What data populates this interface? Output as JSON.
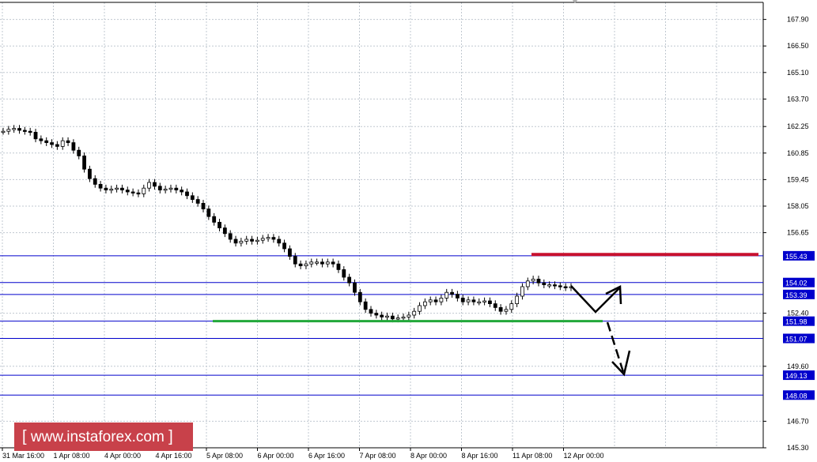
{
  "chart_data": {
    "type": "candlestick",
    "y_axis_ticks": [
      "167.90",
      "166.50",
      "165.10",
      "163.70",
      "162.25",
      "160.85",
      "159.45",
      "158.05",
      "156.65",
      "154.02",
      "153.39",
      "152.40",
      "151.98",
      "151.07",
      "149.60",
      "149.13",
      "148.08",
      "146.70",
      "145.30"
    ],
    "x_axis_ticks": [
      "31 Mar 16:00",
      "1 Apr 08:00",
      "4 Apr 00:00",
      "4 Apr 16:00",
      "5 Apr 08:00",
      "6 Apr 00:00",
      "6 Apr 16:00",
      "7 Apr 08:00",
      "8 Apr 00:00",
      "8 Apr 16:00",
      "11 Apr 08:00",
      "12 Apr 00:00"
    ],
    "ylim": [
      145.3,
      168.8
    ],
    "grid": true,
    "price_candles": [
      162.0,
      162.1,
      162.15,
      162.05,
      162.0,
      161.95,
      161.6,
      161.5,
      161.4,
      161.3,
      161.2,
      161.5,
      161.4,
      161.0,
      160.7,
      160.0,
      159.5,
      159.2,
      159.0,
      158.9,
      158.95,
      159.0,
      158.9,
      158.8,
      158.75,
      158.7,
      159.0,
      159.3,
      159.1,
      158.9,
      158.95,
      159.0,
      158.9,
      158.8,
      158.6,
      158.4,
      158.2,
      157.9,
      157.5,
      157.2,
      156.9,
      156.6,
      156.3,
      156.1,
      156.2,
      156.3,
      156.2,
      156.25,
      156.35,
      156.4,
      156.3,
      156.1,
      155.8,
      155.4,
      155.0,
      154.9,
      155.0,
      155.1,
      155.1,
      155.0,
      155.1,
      155.0,
      154.7,
      154.3,
      154.0,
      153.5,
      153.0,
      152.6,
      152.4,
      152.3,
      152.2,
      152.25,
      152.1,
      152.15,
      152.2,
      152.3,
      152.5,
      152.8,
      153.0,
      153.1,
      153.0,
      153.2,
      153.5,
      153.4,
      153.2,
      153.0,
      153.1,
      153.0,
      153.0,
      153.05,
      152.9,
      152.7,
      152.5,
      152.6,
      152.9,
      153.3,
      153.8,
      154.1,
      154.2,
      154.0,
      153.9,
      153.9,
      153.85,
      153.8,
      153.75,
      153.8
    ],
    "horizontal_levels": [
      {
        "label": "155.43",
        "value": 155.43,
        "color": "#0000cc"
      },
      {
        "label": "154.02",
        "value": 154.02,
        "color": "#0000cc"
      },
      {
        "label": "153.39",
        "value": 153.39,
        "color": "#0000cc"
      },
      {
        "label": "151.98",
        "value": 151.98,
        "color": "#0000cc"
      },
      {
        "label": "151.07",
        "value": 151.07,
        "color": "#0000cc"
      },
      {
        "label": "149.13",
        "value": 149.13,
        "color": "#0000cc"
      },
      {
        "label": "148.08",
        "value": 148.08,
        "color": "#0000cc"
      }
    ],
    "annotations": {
      "resistance_segment": {
        "value": 155.5,
        "color": "#c8102e"
      },
      "support_segment": {
        "value": 151.98,
        "color": "#22a83a"
      },
      "forecast_path_color": "#000000"
    },
    "colors": {
      "grid": "#c0c8d0",
      "level": "#0000cc",
      "axis_label_bg": "#0000cc"
    }
  },
  "watermark": {
    "bracket_open": "[",
    "text": "www.instaforex.com",
    "bracket_close": "]"
  }
}
